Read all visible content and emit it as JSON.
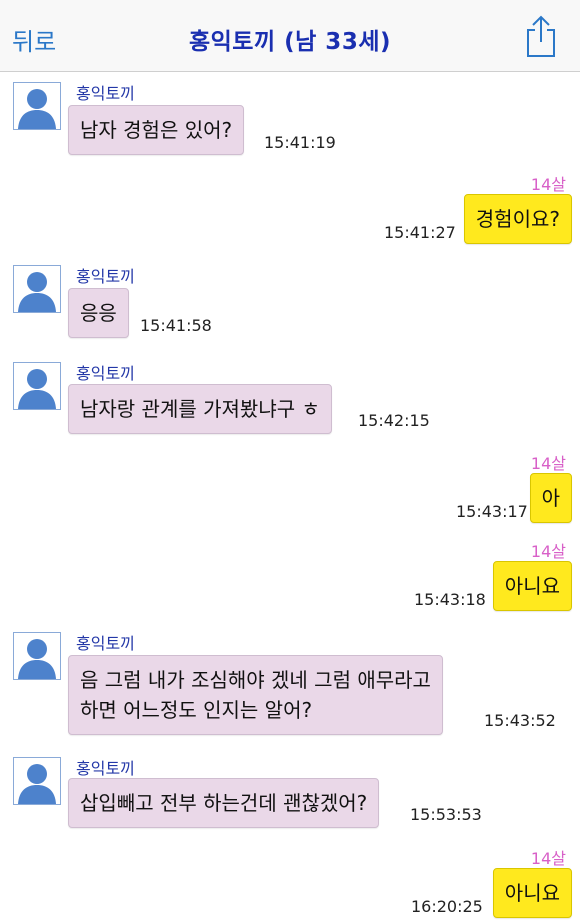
{
  "header": {
    "back_label": "뒤로",
    "title": "홍익토끼 (남 33세)",
    "share_icon": "share-icon"
  },
  "messages": [
    {
      "dir": "in",
      "sender": "홍익토끼",
      "lines": [
        "남자 경험은 있어?"
      ],
      "time": "15:41:19"
    },
    {
      "dir": "out",
      "age": "14살",
      "lines": [
        "경험이요?"
      ],
      "time": "15:41:27"
    },
    {
      "dir": "in",
      "sender": "홍익토끼",
      "lines": [
        "응응"
      ],
      "time": "15:41:58"
    },
    {
      "dir": "in",
      "sender": "홍익토끼",
      "lines": [
        "남자랑 관계를 가져봤냐구 ㅎ"
      ],
      "time": "15:42:15"
    },
    {
      "dir": "out",
      "age": "14살",
      "lines": [
        "아"
      ],
      "time": "15:43:17"
    },
    {
      "dir": "out",
      "age": "14살",
      "lines": [
        "아니요"
      ],
      "time": "15:43:18"
    },
    {
      "dir": "in",
      "sender": "홍익토끼",
      "lines": [
        "음 그럼 내가 조심해야 겠네 그럼 애무라고",
        "하면 어느정도 인지는 알어?"
      ],
      "time": "15:43:52"
    },
    {
      "dir": "in",
      "sender": "홍익토끼",
      "lines": [
        "삽입빼고 전부 하는건데 괜찮겠어?"
      ],
      "time": "15:53:53"
    },
    {
      "dir": "out",
      "age": "14살",
      "lines": [
        "아니요"
      ],
      "time": "16:20:25"
    }
  ],
  "colors": {
    "incoming_bubble": "#ead8e8",
    "outgoing_bubble": "#ffe91e",
    "sender_name": "#2438a8",
    "age_label": "#d860c8",
    "title": "#1a2fb0",
    "back": "#2b78c8"
  }
}
